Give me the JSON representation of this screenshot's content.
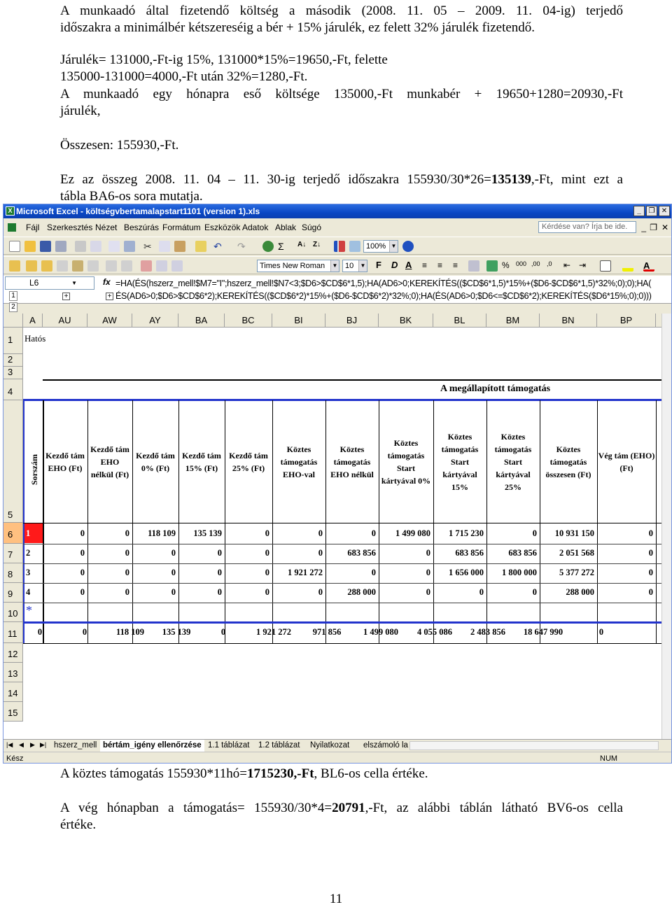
{
  "paragraphs": {
    "p1_l1": "A munkaadó által fizetendő költség a második (2008. 11. 05 – 2009. 11. 04-ig) terjedő",
    "p1_l2": "időszakra a minimálbér kétszereséig a bér + 15% járulék, ez felett 32% járulék fizetendő.",
    "p2_l1": "Járulék= 131000,-Ft-ig 15%, 131000*15%=19650,-Ft, felette",
    "p2_l2": "135000-131000=4000,-Ft után 32%=1280,-Ft.",
    "p3_l1": "A munkaadó egy hónapra eső költsége 135000,-Ft munkabér + 19650+1280=20930,-Ft",
    "p3_l2": "járulék,",
    "p4": "Összesen: 155930,-Ft.",
    "p5_l1_a": "Ez az összeg 2008. 11. 04 – 11. 30-ig terjedő időszakra 155930/30*26=",
    "p5_l1_b": "135139",
    "p5_l1_c": ",-Ft, mint ezt a",
    "p5_l2": "tábla BA6-os sora mutatja.",
    "p6_a": "A köztes támogatás 155930*11hó=",
    "p6_b": "1715230,-Ft",
    "p6_c": ", BL6-os cella értéke.",
    "p7_l1_a": "A vég hónapban a támogatás= 155930/30*4=",
    "p7_l1_b": "20791",
    "p7_l1_c": ",-Ft, az alábbi táblán látható BV6-os cella",
    "p7_l2": "értéke."
  },
  "page_number": "11",
  "excel": {
    "window_title": "Microsoft Excel - költségvbertamalapstart1101 (version 1).xls",
    "menu": [
      "Fájl",
      "Szerkesztés",
      "Nézet",
      "Beszúrás",
      "Formátum",
      "Eszközök",
      "Adatok",
      "Ablak",
      "Súgó"
    ],
    "help_placeholder": "Kérdése van? Írja be ide.",
    "zoom": "100%",
    "font_name": "Times New Roman",
    "font_size": "10",
    "bold": "F",
    "italic": "D",
    "underline": "A",
    "name_box": "L6",
    "fx": "fx",
    "formula_l1": "=HA(ÉS(hszerz_mell!$M7=\"I\";hszerz_mell!$N7<3;$D6>$CD$6*1,5);HA(AD6>0;KEREKÍTÉS(($CD$6*1,5)*15%+($D6-$CD$6*1,5)*32%;0);0);HA(",
    "formula_l2": "ÉS(AD6>0;$D6>$CD$6*2);KEREKÍTÉS(($CD$6*2)*15%+($D6-$CD$6*2)*32%;0);HA(ÉS(AD6>0;$D6<=$CD$6*2);KEREKÍTÉS($D6*15%;0);0)))",
    "outline_levels": [
      "1",
      "2"
    ],
    "columns": [
      "A",
      "AU",
      "AW",
      "AY",
      "BA",
      "BC",
      "BI",
      "BJ",
      "BK",
      "BL",
      "BM",
      "BN",
      "BP"
    ],
    "rows": [
      "1",
      "2",
      "3",
      "4",
      "5",
      "6",
      "7",
      "8",
      "9",
      "10",
      "11",
      "12",
      "13",
      "14",
      "15"
    ],
    "row1_text": "Hatós",
    "group_title": "A megállapított támogatás",
    "header_sorszam": "Sorszám",
    "headers": [
      [
        "Kezdő tám",
        "EHO (Ft)"
      ],
      [
        "Kezdő tám",
        "EHO",
        "nélkül (Ft)"
      ],
      [
        "Kezdő tám",
        "0% (Ft)"
      ],
      [
        "Kezdő tám",
        "15% (Ft)"
      ],
      [
        "Kezdő tám",
        "25% (Ft)"
      ],
      [
        "Köztes",
        "támogatás",
        "EHO-val"
      ],
      [
        "Köztes",
        "támogatás",
        "EHO nélkül"
      ],
      [
        "Köztes",
        "támogatás",
        "Start",
        "kártyával 0%"
      ],
      [
        "Köztes",
        "támogatás",
        "Start",
        "kártyával",
        "15%"
      ],
      [
        "Köztes",
        "támogatás",
        "Start",
        "kártyával",
        "25%"
      ],
      [
        "Köztes",
        "támogatás",
        "összesen (Ft)"
      ],
      [
        "Vég tám (EHO)",
        "(Ft)"
      ]
    ],
    "data_rows": [
      {
        "no": "1",
        "vals": [
          "0",
          "0",
          "118 109",
          "135 139",
          "0",
          "0",
          "0",
          "1 499 080",
          "1 715 230",
          "0",
          "10 931 150",
          "0"
        ]
      },
      {
        "no": "2",
        "vals": [
          "0",
          "0",
          "0",
          "0",
          "0",
          "0",
          "683 856",
          "0",
          "683 856",
          "683 856",
          "2 051 568",
          "0"
        ]
      },
      {
        "no": "3",
        "vals": [
          "0",
          "0",
          "0",
          "0",
          "0",
          "1 921 272",
          "0",
          "0",
          "1 656 000",
          "1 800 000",
          "5 377 272",
          "0"
        ]
      },
      {
        "no": "4",
        "vals": [
          "0",
          "0",
          "0",
          "0",
          "0",
          "0",
          "288 000",
          "0",
          "0",
          "0",
          "288 000",
          "0"
        ]
      }
    ],
    "new_row_marker": "*",
    "totals": [
      "0",
      "0",
      "118 109",
      "135 139",
      "0",
      "1 921 272",
      "971 856",
      "1 499 080",
      "4 055 086",
      "2 483 856",
      "18 647 990",
      "0"
    ],
    "sheet_tabs": [
      "hszerz_mell",
      "bértám_igény ellenőrzése",
      "1.1 táblázat",
      "1.2 táblázat",
      "Nyilatkozat",
      "elszámoló la"
    ],
    "status_left": "Kész",
    "status_right": "NUM"
  }
}
